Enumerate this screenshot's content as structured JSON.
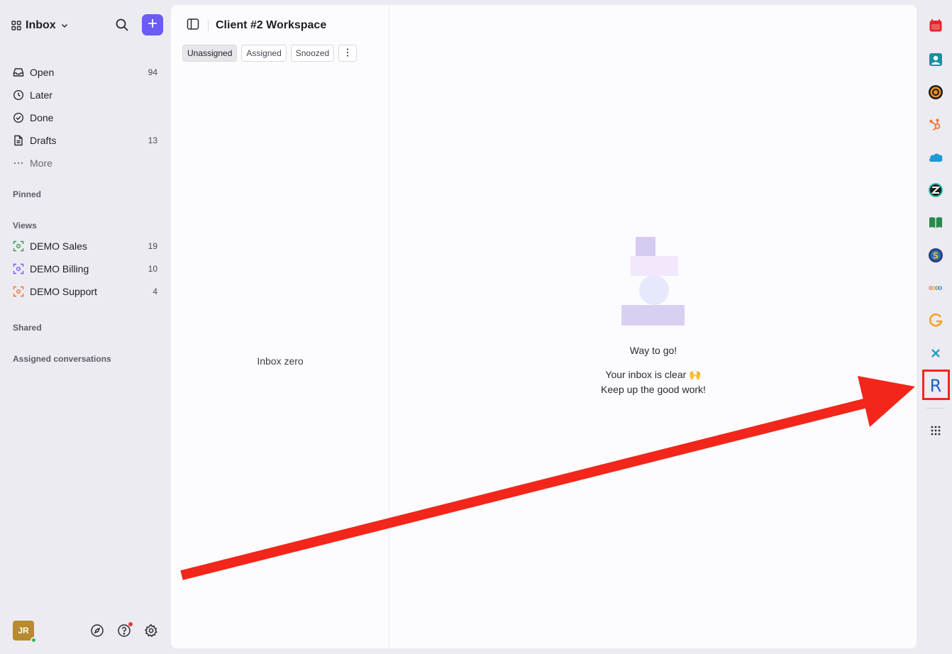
{
  "sidebar": {
    "title": "Inbox",
    "nav": [
      {
        "label": "Open",
        "count": "94",
        "icon": "inbox-icon"
      },
      {
        "label": "Later",
        "count": "",
        "icon": "clock-icon"
      },
      {
        "label": "Done",
        "count": "",
        "icon": "check-circle-icon"
      },
      {
        "label": "Drafts",
        "count": "13",
        "icon": "document-icon"
      },
      {
        "label": "More",
        "count": "",
        "icon": "ellipsis-icon"
      }
    ],
    "sections": {
      "pinned": "Pinned",
      "views": "Views",
      "shared": "Shared",
      "assigned": "Assigned conversations"
    },
    "views": [
      {
        "label": "DEMO Sales",
        "count": "19",
        "color": "#2e9e4f"
      },
      {
        "label": "DEMO Billing",
        "count": "10",
        "color": "#6a5cf5"
      },
      {
        "label": "DEMO Support",
        "count": "4",
        "color": "#f0712f"
      }
    ],
    "avatar_initials": "JR"
  },
  "list_pane": {
    "title": "Client #2 Workspace",
    "tabs": [
      "Unassigned",
      "Assigned",
      "Snoozed"
    ],
    "empty_text": "Inbox zero"
  },
  "detail_pane": {
    "title": "Way to go!",
    "line1": "Your inbox is clear 🙌",
    "line2": "Keep up the good work!"
  },
  "rail_icons": [
    "calendar-icon",
    "contact-card-icon",
    "target-icon",
    "hubspot-icon",
    "salesforce-icon",
    "zendesk-icon",
    "book-icon",
    "s-coin-icon",
    "dots-chain-icon",
    "g-icon",
    "x-icon",
    "r-icon",
    "apps-grid-icon"
  ],
  "colors": {
    "accent": "#6a5cf5",
    "highlight": "#f2261a"
  }
}
